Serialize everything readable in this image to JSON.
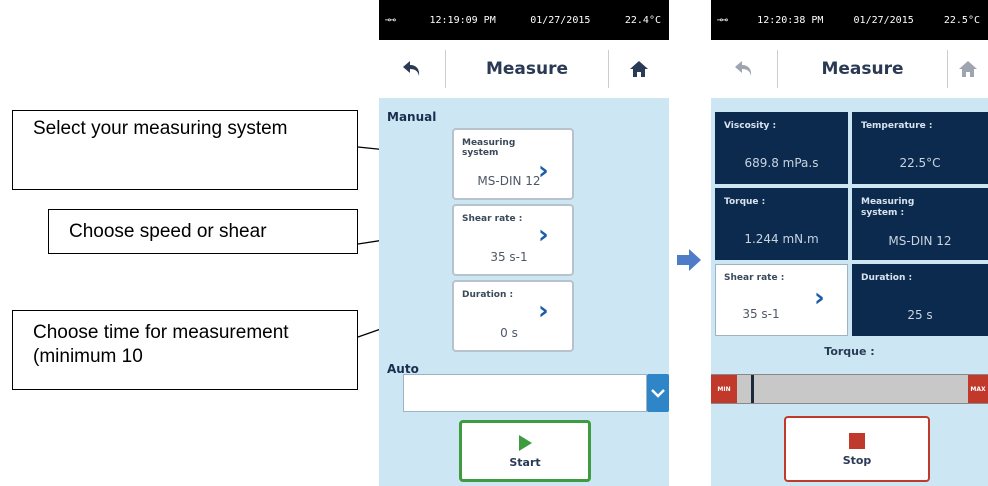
{
  "callouts": [
    "Select your measuring system",
    "Choose speed or shear",
    "Choose time for measurement (minimum 10"
  ],
  "left_screen": {
    "status": {
      "icons": "usb-icons",
      "time": "12:19:09 PM",
      "date": "01/27/2015",
      "temp": "22.4°C"
    },
    "title": "Measure",
    "manual_label": "Manual",
    "cards": [
      {
        "title": "Measuring system",
        "value": "MS-DIN 12"
      },
      {
        "title": "Shear rate :",
        "value": "35 s-1"
      },
      {
        "title": "Duration :",
        "value": "0 s"
      }
    ],
    "auto_label": "Auto",
    "auto_select_value": "",
    "start_label": "Start"
  },
  "right_screen": {
    "status": {
      "icons": "usb-icons",
      "time": "12:20:38 PM",
      "date": "01/27/2015",
      "temp": "22.5°C"
    },
    "title": "Measure",
    "tiles": [
      {
        "title": "Viscosity :",
        "value": "689.8 mPa.s"
      },
      {
        "title": "Temperature :",
        "value": "22.5°C"
      },
      {
        "title": "Torque :",
        "value": "1.244 mN.m"
      },
      {
        "title": "Measuring system :",
        "value": "MS-DIN 12"
      },
      {
        "title": "Duration :",
        "value": "25 s"
      }
    ],
    "shear_card": {
      "title": "Shear rate :",
      "value": "35 s-1"
    },
    "torque_label": "Torque :",
    "torque_bar": {
      "level_fraction": 0.0,
      "min_label": "MIN",
      "max_label": "MAX"
    },
    "stop_label": "Stop"
  },
  "colors": {
    "screen_bg": "#cce7f3",
    "tile_bg": "#0b2a4e",
    "accent": "#1a5da8",
    "start": "#3f9b3f",
    "stop": "#c03a2b"
  }
}
